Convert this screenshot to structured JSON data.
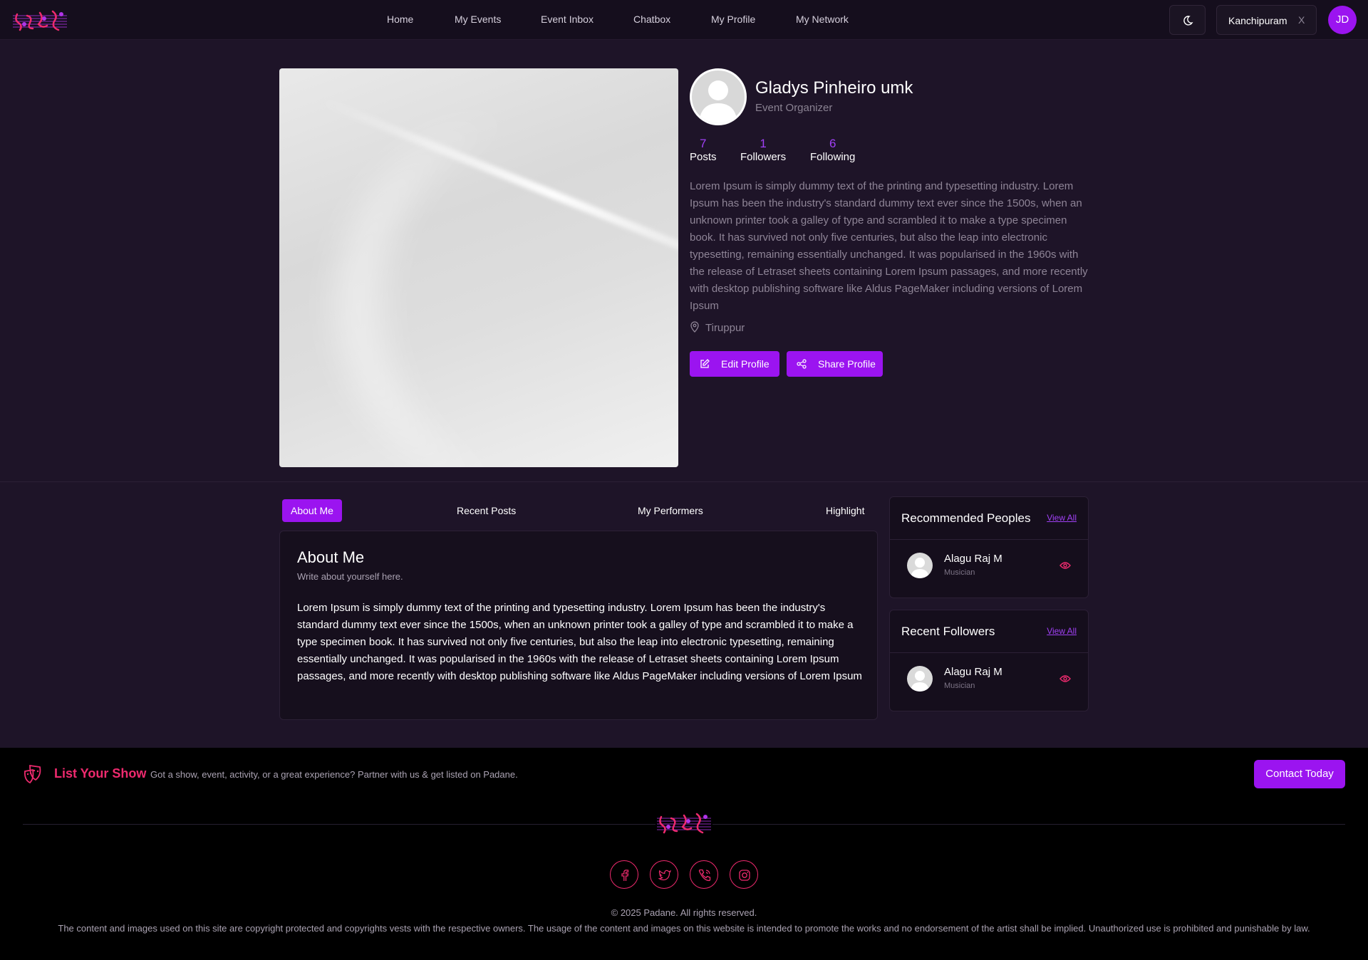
{
  "nav": {
    "links": [
      "Home",
      "My Events",
      "Event Inbox",
      "Chatbox",
      "My Profile",
      "My Network"
    ],
    "location": "Kanchipuram",
    "location_clear": "X",
    "user_initials": "JD"
  },
  "profile": {
    "name": "Gladys Pinheiro umk",
    "role": "Event Organizer",
    "stats": [
      {
        "value": "7",
        "label": "Posts"
      },
      {
        "value": "1",
        "label": "Followers"
      },
      {
        "value": "6",
        "label": "Following"
      }
    ],
    "bio": "Lorem Ipsum is simply dummy text of the printing and typesetting industry. Lorem Ipsum has been the industry's standard dummy text ever since the 1500s, when an unknown printer took a galley of type and scrambled it to make a type specimen book. It has survived not only five centuries, but also the leap into electronic typesetting, remaining essentially unchanged. It was popularised in the 1960s with the release of Letraset sheets containing Lorem Ipsum passages, and more recently with desktop publishing software like Aldus PageMaker including versions of Lorem Ipsum",
    "location": "Tiruppur",
    "edit_label": "Edit Profile",
    "share_label": "Share Profile"
  },
  "tabs": [
    "About Me",
    "Recent Posts",
    "My Performers",
    "Highlight"
  ],
  "about": {
    "title": "About Me",
    "subtitle": "Write about yourself here.",
    "text": "Lorem Ipsum is simply dummy text of the printing and typesetting industry. Lorem Ipsum has been the industry's standard dummy text ever since the 1500s, when an unknown printer took a galley of type and scrambled it to make a type specimen book. It has survived not only five centuries, but also the leap into electronic typesetting, remaining essentially unchanged. It was popularised in the 1960s with the release of Letraset sheets containing Lorem Ipsum passages, and more recently with desktop publishing software like Aldus PageMaker including versions of Lorem Ipsum"
  },
  "recommended": {
    "title": "Recommended Peoples",
    "view_all": "View All",
    "people": [
      {
        "name": "Alagu Raj M",
        "role": "Musician"
      }
    ]
  },
  "recent_followers": {
    "title": "Recent Followers",
    "view_all": "View All",
    "people": [
      {
        "name": "Alagu Raj M",
        "role": "Musician"
      }
    ]
  },
  "footer": {
    "list_title": "List Your Show",
    "list_text": "Got a show, event, activity, or a great experience? Partner with us & get listed on Padane.",
    "contact_label": "Contact Today",
    "social_icons": [
      "facebook-icon",
      "twitter-icon",
      "phone-icon",
      "instagram-icon"
    ],
    "copyright": "© 2025 Padane. All rights reserved.",
    "disclaimer": "The content and images used on this site are copyright protected and copyrights vests with the respective owners. The usage of the content and images on this website is intended to promote the works and no endorsement of the artist shall be implied. Unauthorized use is prohibited and punishable by law."
  },
  "colors": {
    "accent": "#9b14f0",
    "brand_pink": "#ee2a6e",
    "background": "#1e1428",
    "footer_bg": "#000000"
  }
}
